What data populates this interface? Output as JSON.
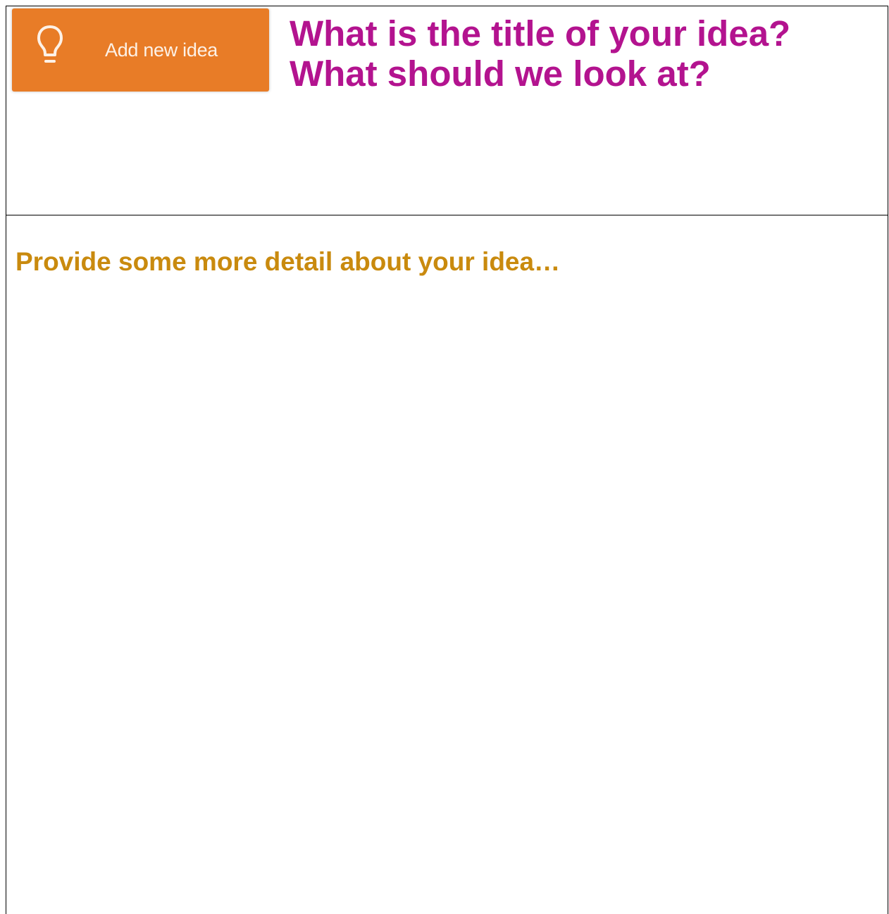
{
  "button": {
    "label": "Add new idea",
    "icon": "lightbulb-icon",
    "background_color": "#e87c27"
  },
  "title_section": {
    "prompt_line1": "What is the title of your idea?",
    "prompt_line2": "What should we look at?",
    "color": "#b3138f"
  },
  "detail_section": {
    "prompt": "Provide some more detail about your idea…",
    "color": "#c98a0e"
  }
}
